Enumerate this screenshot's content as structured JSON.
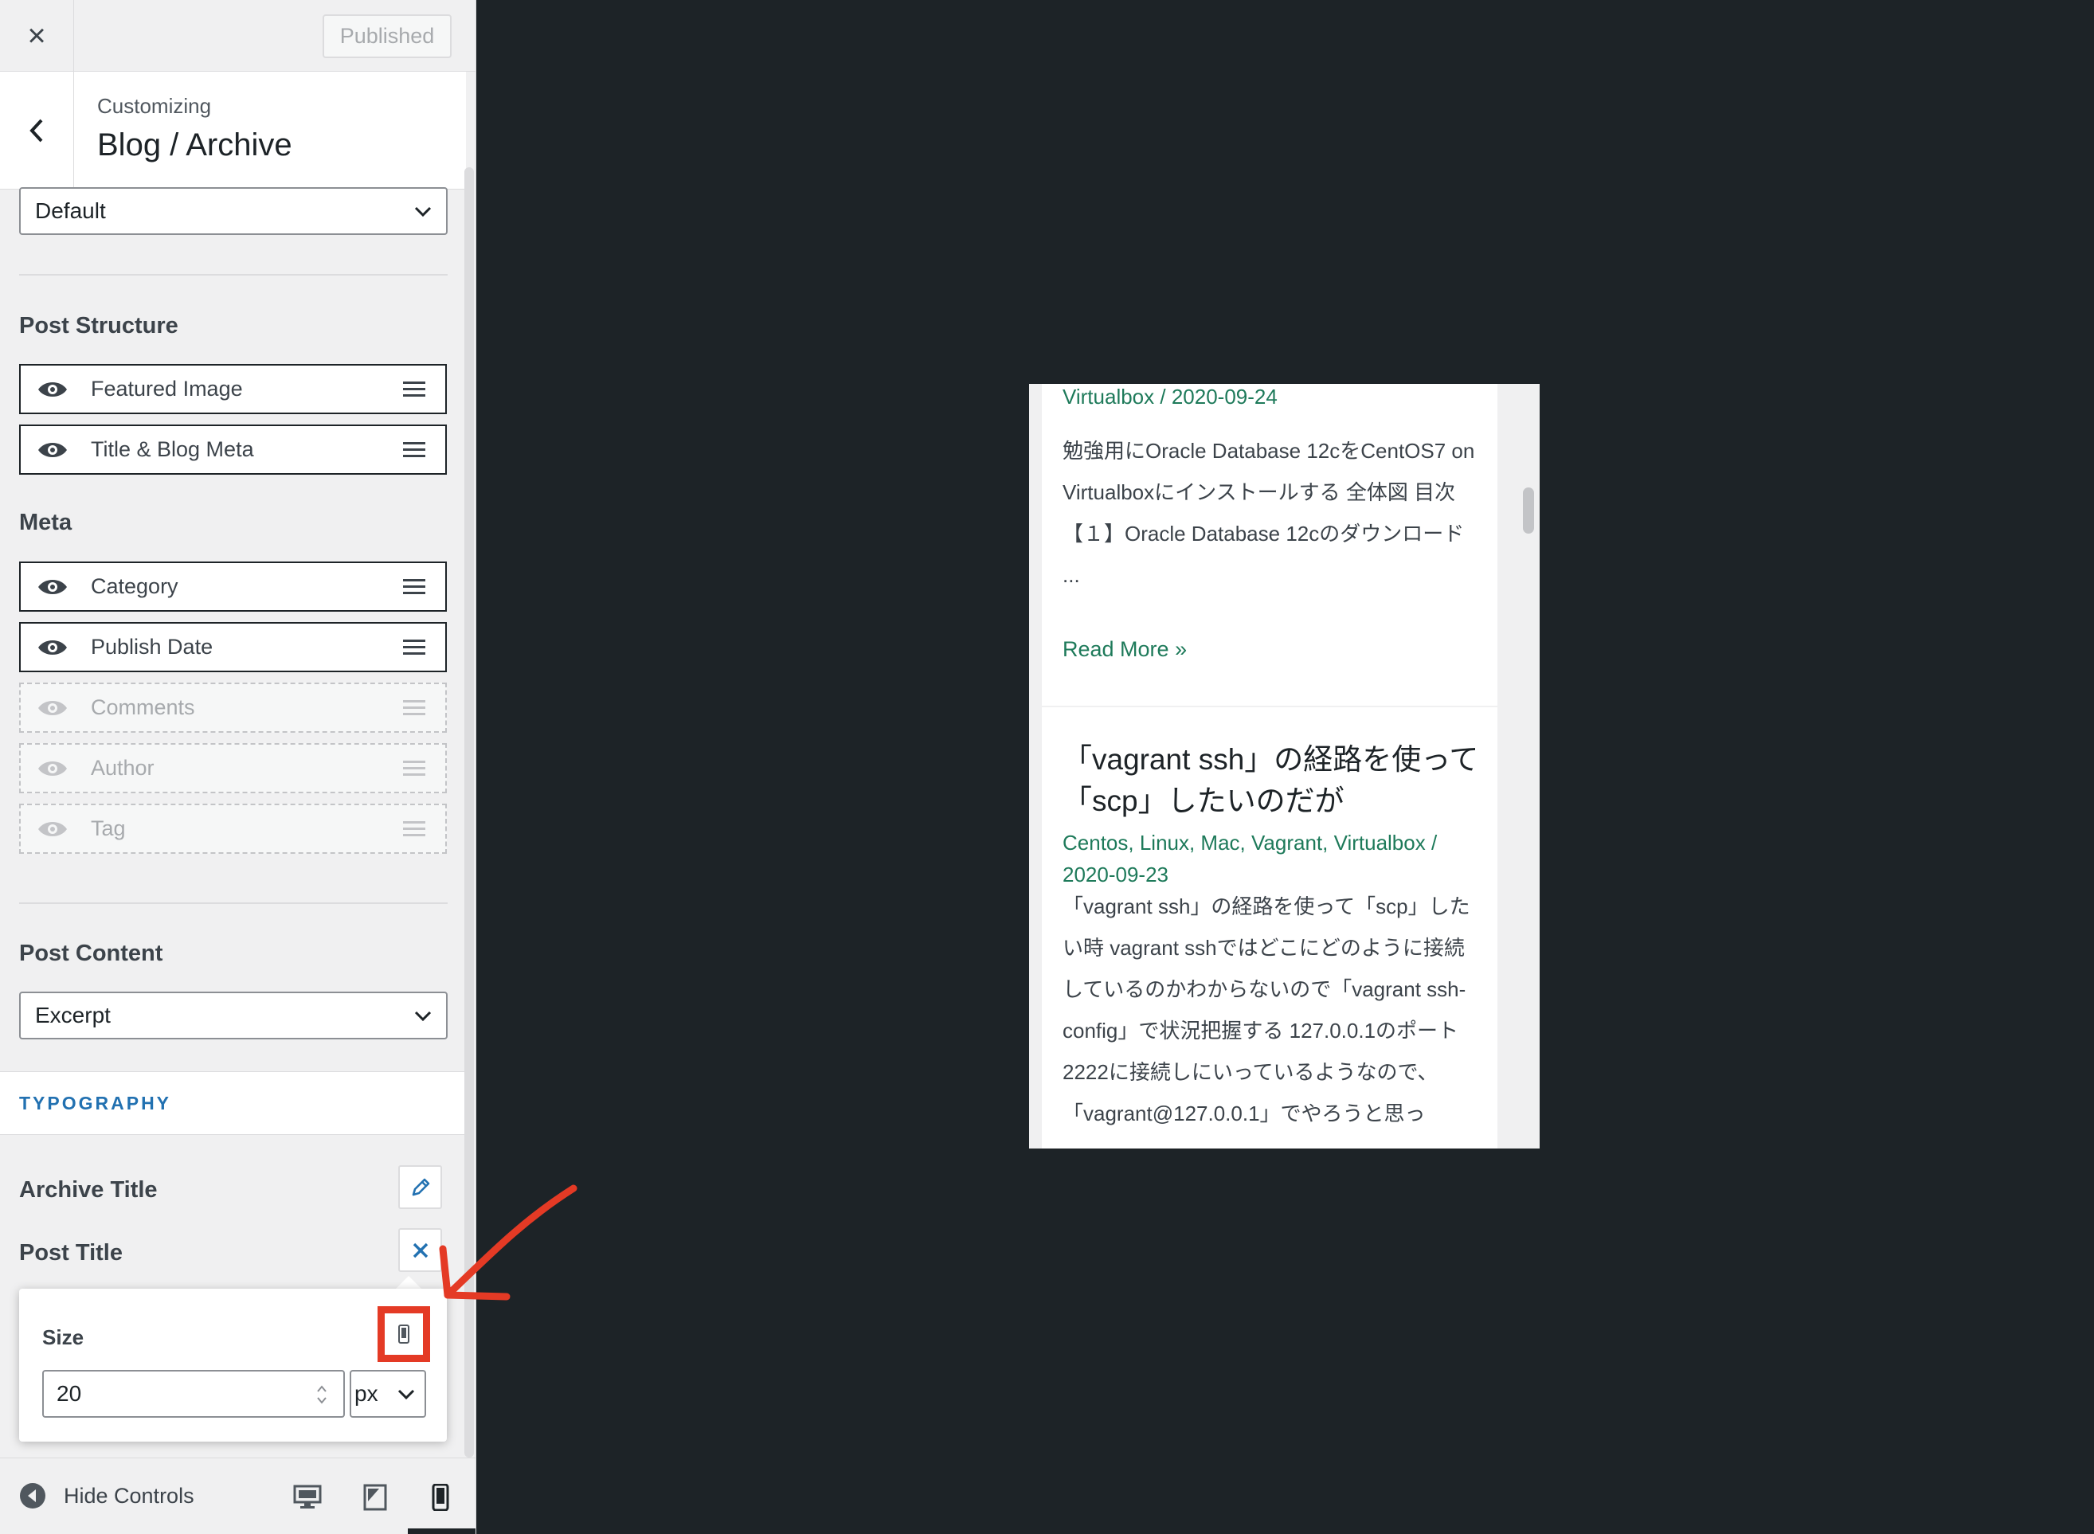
{
  "topbar": {
    "close_icon": "×",
    "publish_label": "Published"
  },
  "section": {
    "customizing_label": "Customizing",
    "title": "Blog / Archive"
  },
  "layout_select": {
    "value": "Default"
  },
  "post_structure": {
    "heading": "Post Structure",
    "items": [
      {
        "label": "Featured Image",
        "enabled": true
      },
      {
        "label": "Title & Blog Meta",
        "enabled": true
      }
    ]
  },
  "meta": {
    "heading": "Meta",
    "items": [
      {
        "label": "Category",
        "enabled": true
      },
      {
        "label": "Publish Date",
        "enabled": true
      },
      {
        "label": "Comments",
        "enabled": false
      },
      {
        "label": "Author",
        "enabled": false
      },
      {
        "label": "Tag",
        "enabled": false
      }
    ]
  },
  "post_content": {
    "heading": "Post Content",
    "value": "Excerpt"
  },
  "typography": {
    "band_label": "TYPOGRAPHY",
    "archive_title_label": "Archive Title",
    "post_title_label": "Post Title",
    "size_label": "Size",
    "size_value": "20",
    "unit_value": "px"
  },
  "footer": {
    "hide_controls_label": "Hide Controls",
    "active_device": "mobile"
  },
  "preview": {
    "post1_meta": "Virtualbox / 2020-09-24",
    "post1_excerpt": "勉強用にOracle Database 12cをCentOS7 on Virtualboxにインストールする 全体図 目次 【１】Oracle Database 12cのダウンロード ...",
    "post1_readmore": "Read More »",
    "post2_title": "「vagrant ssh」の経路を使って「scp」したいのだが",
    "post2_meta": "Centos, Linux, Mac, Vagrant, Virtualbox / 2020-09-23",
    "post2_excerpt": "「vagrant ssh」の経路を使って「scp」したい時 vagrant sshではどこにどのように接続しているのかわからないので「vagrant ssh-config」で状況把握する 127.0.0.1のポート2222に接続しにいっているようなので、「vagrant@127.0.0.1」でやろうと思っ"
  },
  "colors": {
    "accent_blue": "#2271b1",
    "link_green": "#1e7a5a",
    "annotation_red": "#e43a25",
    "preview_backdrop": "#1d2327"
  }
}
